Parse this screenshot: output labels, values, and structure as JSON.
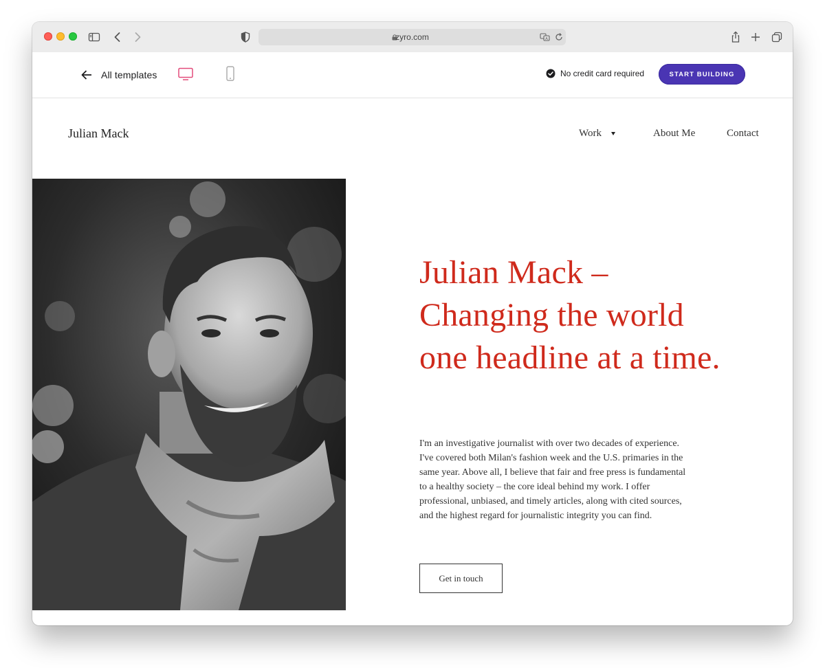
{
  "browser": {
    "url": "zyro.com",
    "icons": [
      "sidebar-icon",
      "back-icon",
      "forward-icon",
      "shield-icon",
      "lock-icon",
      "translate-icon",
      "reload-icon",
      "share-icon",
      "plus-icon",
      "tabs-icon"
    ]
  },
  "builder": {
    "back_label": "All templates",
    "no_cc_label": "No credit card required",
    "cta_label": "START BUILDING",
    "accent_color": "#4a35b3",
    "active_device_color": "#e24b7a"
  },
  "site": {
    "logo": "Julian Mack",
    "nav": [
      "Work",
      "About Me",
      "Contact"
    ],
    "headline_lines": [
      "Julian Mack –",
      "Changing the world",
      "one headline at a time."
    ],
    "intro_lines": [
      "I'm an investigative journalist with over two decades of experience.",
      "I've covered both Milan's fashion week and the U.S. primaries in the",
      "same year. Above all, I believe that fair and free press is fundamental",
      "to a healthy society – the core ideal behind my work. I offer",
      "professional, unbiased, and timely articles, along with cited sources,",
      "and the highest regard for journalistic integrity you can find."
    ],
    "cta_label": "Get in touch",
    "headline_color": "#cf2a1c"
  }
}
